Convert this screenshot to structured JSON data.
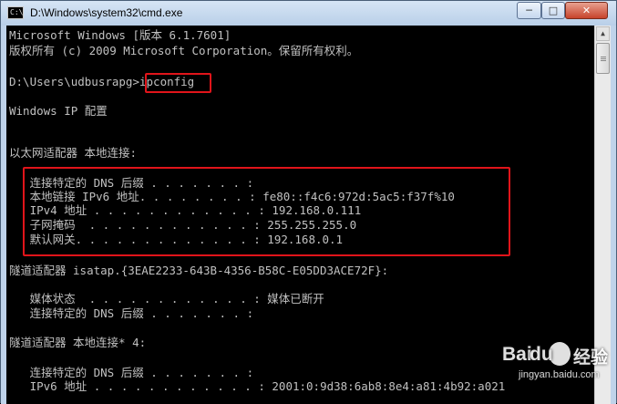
{
  "window": {
    "title": "D:\\Windows\\system32\\cmd.exe",
    "icon_text": "C:\\",
    "controls": {
      "minimize": "─",
      "maximize": "□",
      "close": "✕"
    }
  },
  "console": {
    "lines": [
      "Microsoft Windows [版本 6.1.7601]",
      "版权所有 (c) 2009 Microsoft Corporation。保留所有权利。",
      "",
      "D:\\Users\\udbusrapg>ipconfig",
      "",
      "Windows IP 配置",
      "",
      "",
      "以太网适配器 本地连接:",
      "",
      "   连接特定的 DNS 后缀 . . . . . . . :",
      "   本地链接 IPv6 地址. . . . . . . . : fe80::f4c6:972d:5ac5:f37f%10",
      "   IPv4 地址 . . . . . . . . . . . . : 192.168.0.111",
      "   子网掩码  . . . . . . . . . . . . : 255.255.255.0",
      "   默认网关. . . . . . . . . . . . . : 192.168.0.1",
      "",
      "隧道适配器 isatap.{3EAE2233-643B-4356-B58C-E05DD3ACE72F}:",
      "",
      "   媒体状态  . . . . . . . . . . . . : 媒体已断开",
      "   连接特定的 DNS 后缀 . . . . . . . :",
      "",
      "隧道适配器 本地连接* 4:",
      "",
      "   连接特定的 DNS 后缀 . . . . . . . :",
      "   IPv6 地址 . . . . . . . . . . . . : 2001:0:9d38:6ab8:8e4:a81:4b92:a021"
    ]
  },
  "watermark": {
    "brand_a": "Bai",
    "brand_b": "du",
    "brand_c": "经验",
    "url": "jingyan.baidu.com"
  },
  "colors": {
    "console_bg": "#000000",
    "console_text": "#c0c0c0",
    "highlight": "#e0141a"
  }
}
